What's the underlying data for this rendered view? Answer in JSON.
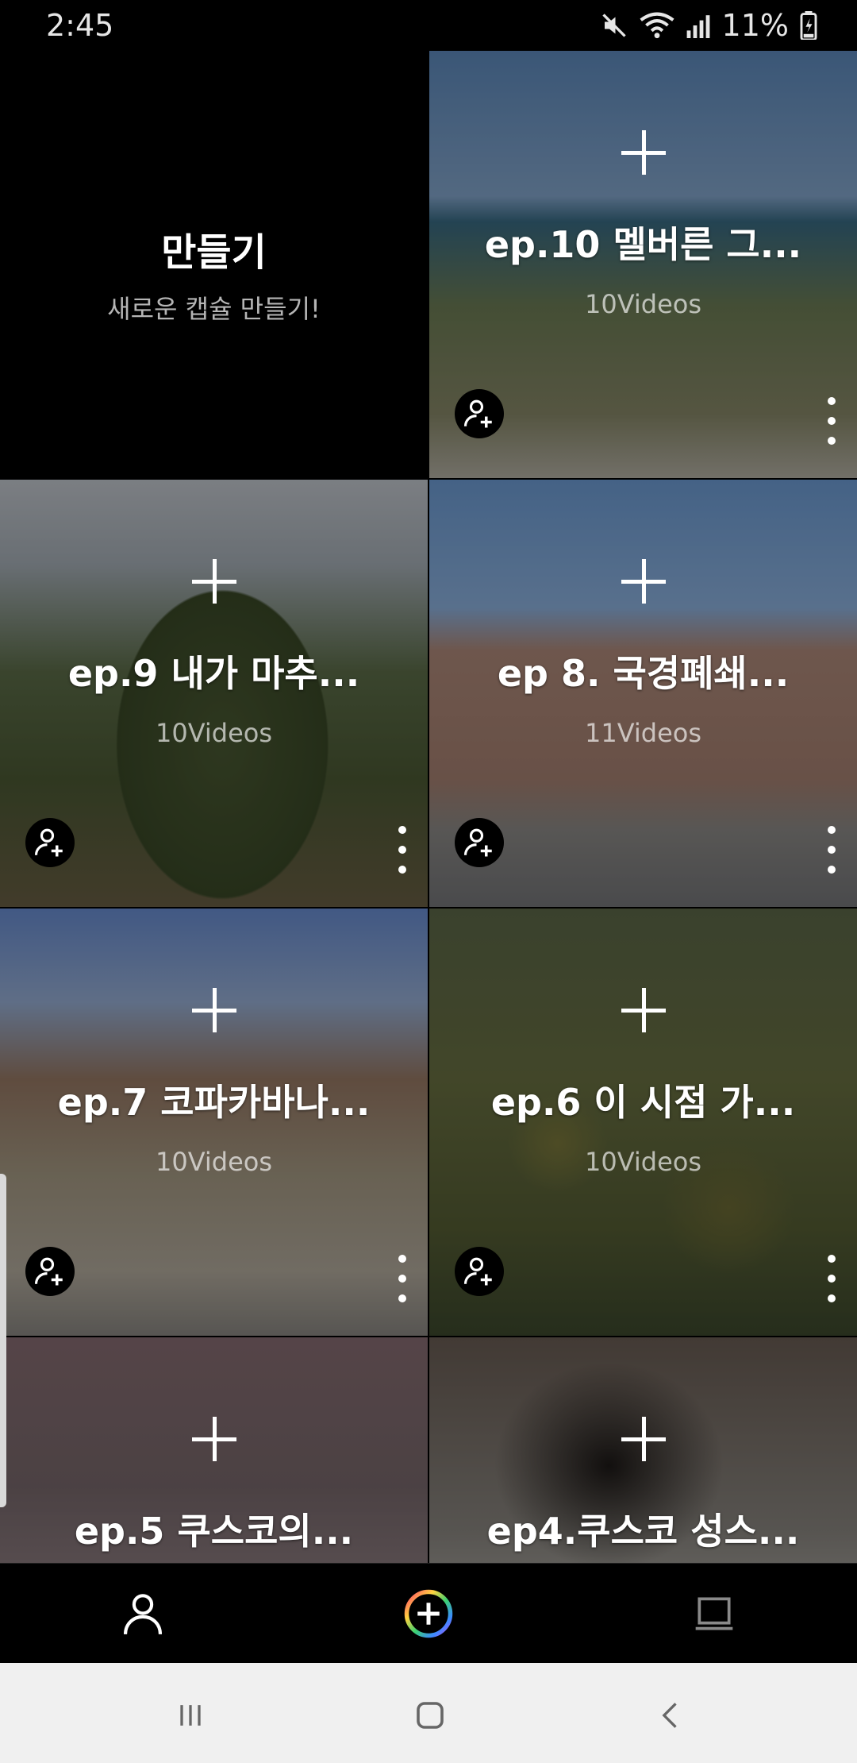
{
  "status_bar": {
    "time": "2:45",
    "battery": "11%",
    "icons": [
      "mute-icon",
      "wifi-icon",
      "signal-icon",
      "battery-charging-icon"
    ]
  },
  "create_tile": {
    "title": "만들기",
    "subtitle": "새로운 캡슐 만들기!"
  },
  "capsules": [
    {
      "title": "ep.10 멜버른 그...",
      "count": "10Videos"
    },
    {
      "title": "ep.9 내가 마추...",
      "count": "10Videos"
    },
    {
      "title": "ep 8. 국경폐쇄...",
      "count": "11Videos"
    },
    {
      "title": "ep.7 코파카바나...",
      "count": "10Videos"
    },
    {
      "title": "ep.6 이 시점 가...",
      "count": "10Videos"
    },
    {
      "title": "ep.5 쿠스코의...",
      "count": ""
    },
    {
      "title": "ep4.쿠스코 성스...",
      "count": ""
    }
  ],
  "bottom_nav": {
    "items": [
      "profile-icon",
      "create-capsule-icon",
      "library-icon"
    ]
  },
  "system_nav": {
    "items": [
      "recents-icon",
      "home-icon",
      "back-icon"
    ]
  },
  "colors": {
    "background": "#000000",
    "system_nav_bg": "#f0f0f0",
    "gradient_ring": [
      "#ff3b6b",
      "#ffd23f",
      "#3bd16f",
      "#3b8bff",
      "#b84dff"
    ]
  }
}
